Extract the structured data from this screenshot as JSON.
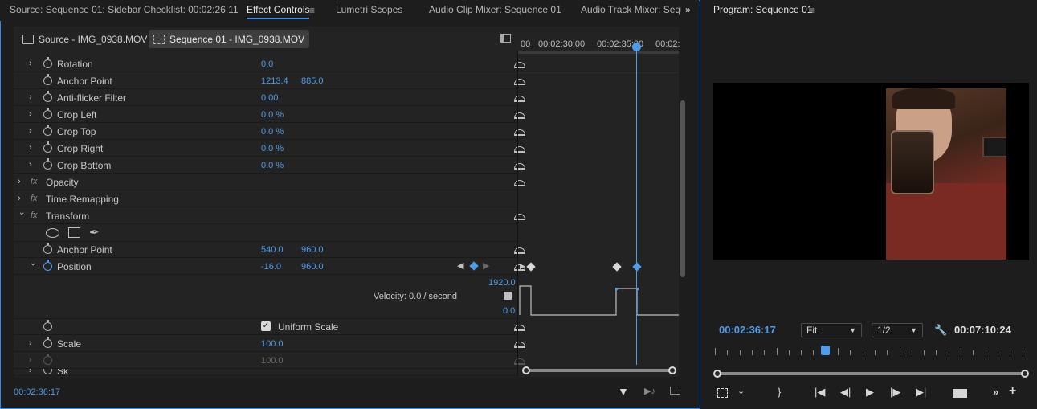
{
  "left_tabs": [
    {
      "label": "Source: Sequence 01: Sidebar Checklist: 00:02:26:11"
    },
    {
      "label": "Effect Controls",
      "active": true,
      "menu": "≡"
    },
    {
      "label": "Lumetri Scopes"
    },
    {
      "label": "Audio Clip Mixer: Sequence 01"
    },
    {
      "label": "Audio Track Mixer: Seque"
    }
  ],
  "overflow": "»",
  "clip_tabs": [
    {
      "label": "Source - IMG_0938.MOV"
    },
    {
      "label": "Sequence 01 - IMG_0938.MOV",
      "active": true
    }
  ],
  "ruler_times": [
    "00",
    "00:02:30:00",
    "00:02:35:00",
    "00:02:"
  ],
  "rows": [
    {
      "label": "Rotation",
      "values": [
        "0.0"
      ]
    },
    {
      "label": "Anchor Point",
      "values": [
        "1213.4",
        "885.0"
      ]
    },
    {
      "label": "Anti-flicker Filter",
      "values": [
        "0.00"
      ]
    },
    {
      "label": "Crop Left",
      "values": [
        "0.0 %"
      ]
    },
    {
      "label": "Crop Top",
      "values": [
        "0.0 %"
      ]
    },
    {
      "label": "Crop Right",
      "values": [
        "0.0 %"
      ]
    },
    {
      "label": "Crop Bottom",
      "values": [
        "0.0 %"
      ]
    },
    {
      "label": "Opacity",
      "fx": "fx"
    },
    {
      "label": "Time Remapping",
      "fx": "fx"
    },
    {
      "label": "Transform",
      "fx": "fx"
    },
    {
      "label": "Anchor Point",
      "values": [
        "540.0",
        "960.0"
      ]
    },
    {
      "label": "Position",
      "values": [
        "-16.0",
        "960.0"
      ]
    },
    {
      "label": "Uniform Scale"
    },
    {
      "label": "Scale",
      "values": [
        "100.0"
      ]
    },
    {
      "label": "",
      "values": [
        "100.0"
      ]
    },
    {
      "label": "Sk"
    }
  ],
  "velocity": {
    "label": "Velocity: 0.0 / second",
    "max": "1920.0",
    "min": "0.0"
  },
  "current_time_left": "00:02:36:17",
  "program": {
    "title": "Program: Sequence 01",
    "menu": "≡",
    "current_time": "00:02:36:17",
    "zoom": "Fit",
    "resolution": "1/2",
    "duration": "00:07:10:24",
    "uniform_scale_checked": true
  },
  "colors": {
    "accent": "#4f9ce8",
    "panel_border": "#2d8ceb"
  }
}
